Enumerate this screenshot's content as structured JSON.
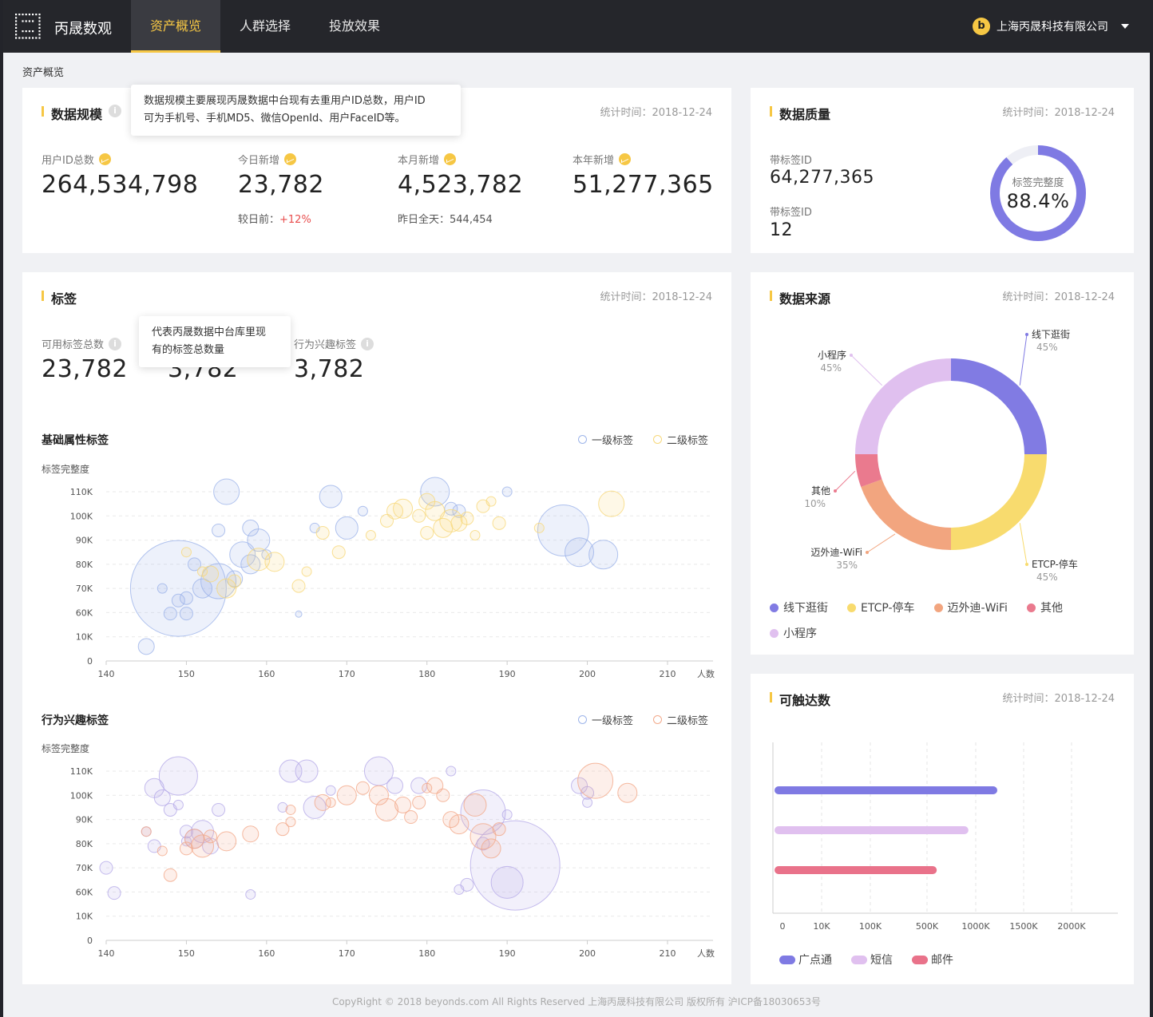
{
  "header": {
    "brand": "丙晟数观",
    "nav": [
      "资产概览",
      "人群选择",
      "投放效果"
    ],
    "active_nav": "资产概览",
    "company": "上海丙晟科技有限公司",
    "company_icon": "b"
  },
  "breadcrumb": "资产概览",
  "scale": {
    "title": "数据规模",
    "stat_time": "统计时间：2018-12-24",
    "tooltip": [
      "数据规模主要展现丙晟数据中台现有去重用户ID总数，用户ID",
      "可为手机号、手机MD5、微信OpenId、用户FaceID等。"
    ],
    "metrics": [
      {
        "label": "用户ID总数",
        "value": "264,534,798"
      },
      {
        "label": "今日新增",
        "value": "23,782",
        "sub_label": "较日前：",
        "sub_value": "+12%"
      },
      {
        "label": "本月新增",
        "value": "4,523,782",
        "sub_label": "昨日全天：544,454"
      },
      {
        "label": "本年新增",
        "value": "51,277,365"
      }
    ]
  },
  "quality": {
    "title": "数据质量",
    "stat_time": "统计时间：2018-12-24",
    "rows": [
      {
        "label": "带标签ID",
        "value": "64,277,365"
      },
      {
        "label": "带标签ID",
        "value": "12"
      }
    ],
    "gauge_label": "标签完整度",
    "gauge_value": "88.4%",
    "gauge_fraction": 0.884,
    "colors": {
      "fill": "#7f7ae3",
      "track": "#eeeff5"
    }
  },
  "tags": {
    "title": "标签",
    "stat_time": "统计时间：2018-12-24",
    "tooltip": [
      "代表丙晟数据中台库里现",
      "有的标签总数量"
    ],
    "metrics": [
      {
        "label": "可用标签总数",
        "value": "23,782"
      },
      {
        "label": "",
        "value": "3,782"
      },
      {
        "label": "行为兴趣标签",
        "value": "3,782"
      }
    ]
  },
  "chart_data": [
    {
      "type": "scatter",
      "title": "基础属性标签",
      "ylabel": "标签完整度",
      "xlabel": "人数",
      "x_ticks": [
        "140",
        "150",
        "160",
        "170",
        "180",
        "190",
        "200",
        "210"
      ],
      "y_ticks": [
        "0",
        "10K",
        "60K",
        "70K",
        "80K",
        "90K",
        "100K",
        "110K"
      ],
      "grid": true,
      "legend_position": "top-right",
      "series": [
        {
          "name": "一级标签",
          "color": "#9db4ea",
          "points": [
            [
              149,
              70,
              30
            ],
            [
              145,
              6,
              5
            ],
            [
              147,
              70,
              3
            ],
            [
              148,
              58,
              4
            ],
            [
              149,
              65,
              4
            ],
            [
              150,
              58,
              4
            ],
            [
              150,
              66,
              4
            ],
            [
              151,
              80,
              4
            ],
            [
              152,
              70,
              6
            ],
            [
              154,
              73,
              11
            ],
            [
              154,
              94,
              4
            ],
            [
              155,
              110,
              8
            ],
            [
              157,
              84,
              8
            ],
            [
              158,
              80,
              6
            ],
            [
              158,
              95,
              5
            ],
            [
              160,
              84,
              3
            ],
            [
              164,
              57,
              2
            ],
            [
              166,
              95,
              3
            ],
            [
              168,
              108,
              7
            ],
            [
              170,
              95,
              7
            ],
            [
              172,
              102,
              3
            ],
            [
              183,
              103,
              4
            ],
            [
              181,
              111,
              9
            ],
            [
              184,
              102,
              4
            ],
            [
              190,
              110,
              3
            ],
            [
              197,
              94,
              16
            ],
            [
              199,
              85,
              9
            ],
            [
              202,
              84,
              9
            ],
            [
              156,
              74,
              5
            ],
            [
              159,
              90,
              7
            ]
          ]
        },
        {
          "name": "二级标签",
          "color": "#f7d87a",
          "points": [
            [
              150,
              85,
              3
            ],
            [
              152,
              77,
              3
            ],
            [
              153,
              76,
              5
            ],
            [
              155,
              70,
              6
            ],
            [
              156,
              73,
              4
            ],
            [
              159,
              82,
              7
            ],
            [
              161,
              81,
              6
            ],
            [
              164,
              71,
              4
            ],
            [
              165,
              77,
              3
            ],
            [
              167,
              93,
              4
            ],
            [
              169,
              85,
              4
            ],
            [
              173,
              92,
              3
            ],
            [
              175,
              98,
              4
            ],
            [
              176,
              102,
              5
            ],
            [
              177,
              103,
              6
            ],
            [
              179,
              100,
              4
            ],
            [
              180,
              106,
              5
            ],
            [
              181,
              102,
              6
            ],
            [
              183,
              98,
              7
            ],
            [
              185,
              99,
              4
            ],
            [
              186,
              92,
              3
            ],
            [
              187,
              104,
              4
            ],
            [
              188,
              106,
              3
            ],
            [
              189,
              97,
              4
            ],
            [
              194,
              95,
              3
            ],
            [
              203,
              105,
              8
            ],
            [
              184,
              97,
              5
            ],
            [
              182,
              95,
              6
            ],
            [
              180,
              93,
              4
            ]
          ]
        }
      ]
    },
    {
      "type": "scatter",
      "title": "行为兴趣标签",
      "ylabel": "标签完整度",
      "xlabel": "人数",
      "x_ticks": [
        "140",
        "150",
        "160",
        "170",
        "180",
        "190",
        "200",
        "210"
      ],
      "y_ticks": [
        "0",
        "10K",
        "60K",
        "70K",
        "80K",
        "90K",
        "100K",
        "110K"
      ],
      "grid": true,
      "legend_position": "top-right",
      "series": [
        {
          "name": "一级标签",
          "color": "#b7abe8",
          "points": [
            [
              140,
              70,
              4
            ],
            [
              141,
              58,
              4
            ],
            [
              145,
              85,
              3
            ],
            [
              146,
              79,
              4
            ],
            [
              146,
              103,
              6
            ],
            [
              147,
              99,
              5
            ],
            [
              148,
              94,
              4
            ],
            [
              149,
              96,
              3
            ],
            [
              149,
              108,
              12
            ],
            [
              150,
              85,
              4
            ],
            [
              150,
              81,
              3
            ],
            [
              151,
              82,
              6
            ],
            [
              152,
              85,
              7
            ],
            [
              153,
              79,
              5
            ],
            [
              154,
              94,
              4
            ],
            [
              158,
              55,
              3
            ],
            [
              162,
              95,
              3
            ],
            [
              163,
              110,
              7
            ],
            [
              165,
              110,
              7
            ],
            [
              166,
              95,
              7
            ],
            [
              168,
              102,
              3
            ],
            [
              174,
              110,
              9
            ],
            [
              176,
              104,
              5
            ],
            [
              179,
              104,
              5
            ],
            [
              183,
              110,
              3
            ],
            [
              184,
              61,
              3
            ],
            [
              185,
              63,
              4
            ],
            [
              187,
              80,
              4
            ],
            [
              187,
              93,
              14
            ],
            [
              191,
              71,
              28
            ],
            [
              190,
              64,
              10
            ],
            [
              190,
              92,
              3
            ],
            [
              199,
              104,
              5
            ],
            [
              200,
              101,
              4
            ],
            [
              200,
              97,
              3
            ]
          ]
        },
        {
          "name": "二级标签",
          "color": "#f2a98a",
          "points": [
            [
              145,
              85,
              3
            ],
            [
              147,
              77,
              3
            ],
            [
              148,
              67,
              4
            ],
            [
              150,
              78,
              4
            ],
            [
              151,
              82,
              6
            ],
            [
              152,
              79,
              7
            ],
            [
              153,
              83,
              4
            ],
            [
              155,
              81,
              6
            ],
            [
              158,
              84,
              5
            ],
            [
              162,
              86,
              4
            ],
            [
              163,
              89,
              3
            ],
            [
              163,
              94,
              3
            ],
            [
              167,
              97,
              5
            ],
            [
              170,
              100,
              6
            ],
            [
              172,
              103,
              4
            ],
            [
              174,
              100,
              6
            ],
            [
              175,
              94,
              7
            ],
            [
              177,
              96,
              5
            ],
            [
              179,
              97,
              4
            ],
            [
              180,
              103,
              3
            ],
            [
              181,
              104,
              5
            ],
            [
              183,
              90,
              5
            ],
            [
              184,
              88,
              6
            ],
            [
              186,
              96,
              7
            ],
            [
              187,
              83,
              8
            ],
            [
              188,
              78,
              6
            ],
            [
              189,
              86,
              4
            ],
            [
              201,
              106,
              11
            ],
            [
              205,
              101,
              6
            ],
            [
              182,
              100,
              4
            ],
            [
              168,
              97,
              3
            ],
            [
              178,
              91,
              4
            ]
          ]
        }
      ]
    },
    {
      "type": "pie",
      "title": "数据来源",
      "stat_time": "统计时间：2018-12-24",
      "slices": [
        {
          "name": "线下逛街",
          "pct": "45%",
          "value": 45,
          "color": "#817be3"
        },
        {
          "name": "ETCP-停车",
          "pct": "45%",
          "value": 45,
          "color": "#f8db6e"
        },
        {
          "name": "迈外迪-WiFi",
          "pct": "35%",
          "value": 35,
          "color": "#f2a57f"
        },
        {
          "name": "其他",
          "pct": "10%",
          "value": 10,
          "color": "#ea7a8e"
        },
        {
          "name": "小程序",
          "pct": "45%",
          "value": 45,
          "color": "#e0c0ef"
        }
      ]
    },
    {
      "type": "bar",
      "title": "可触达数",
      "stat_time": "统计时间：2018-12-24",
      "orientation": "horizontal",
      "x_ticks": [
        "0",
        "10K",
        "100K",
        "500K",
        "1000K",
        "1500K",
        "2000K"
      ],
      "series": [
        {
          "name": "广点通",
          "value_ticks": 4.45,
          "color": "#7f7ae3"
        },
        {
          "name": "短信",
          "value_ticks": 3.85,
          "color": "#e0c0ef"
        },
        {
          "name": "邮件",
          "value_ticks": 3.2,
          "color": "#e9728a"
        }
      ]
    }
  ],
  "footer": "CopyRight © 2018 beyonds.com All Rights Reserved 上海丙晟科技有限公司 版权所有    沪ICP备18030653号"
}
